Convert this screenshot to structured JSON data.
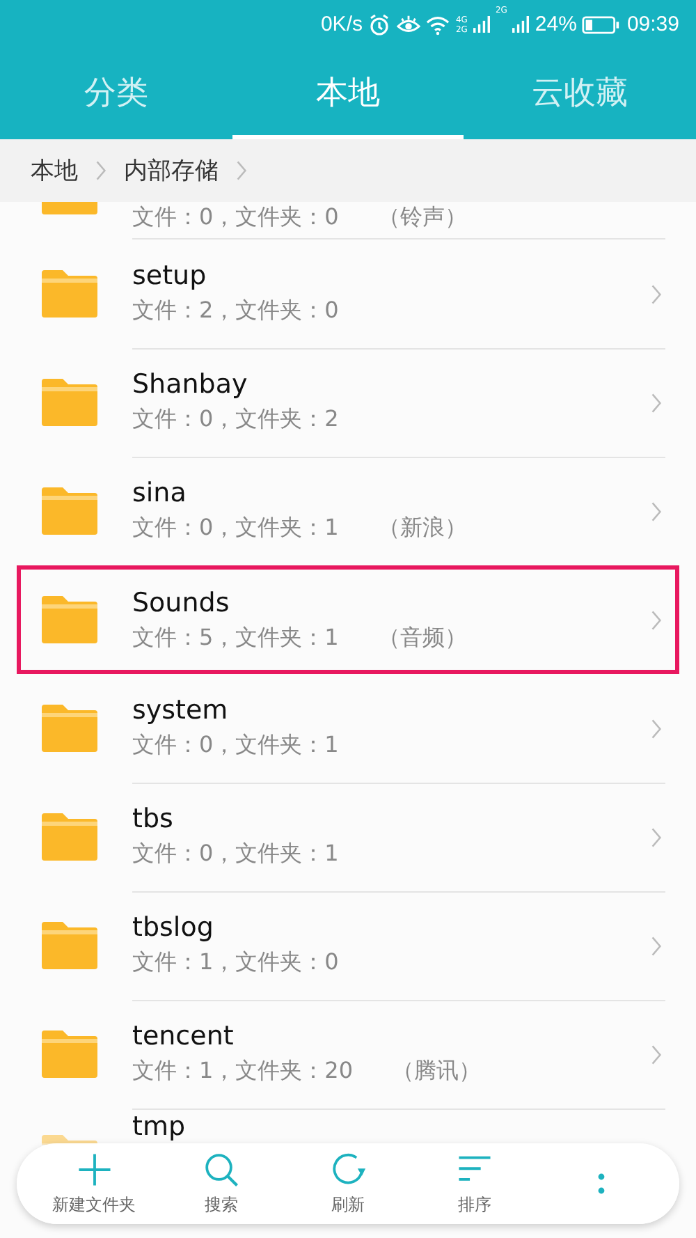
{
  "status_bar": {
    "speed": "0K/s",
    "network_labels": [
      "4G",
      "2G"
    ],
    "network_label_2": "2G",
    "battery_text": "24%",
    "time": "09:39"
  },
  "tabs": [
    {
      "label": "分类",
      "selected": false
    },
    {
      "label": "本地",
      "selected": true
    },
    {
      "label": "云收藏",
      "selected": false
    }
  ],
  "breadcrumb": [
    "本地",
    "内部存储"
  ],
  "folders": [
    {
      "kind": "partial",
      "info": "文件：0，文件夹：0",
      "tag": "（铃声）",
      "highlighted": false
    },
    {
      "kind": "full",
      "name": "setup",
      "info": "文件：2，文件夹：0",
      "highlighted": false
    },
    {
      "kind": "full",
      "name": "Shanbay",
      "info": "文件：0，文件夹：2",
      "highlighted": false
    },
    {
      "kind": "full",
      "name": "sina",
      "info": "文件：0，文件夹：1",
      "tag": "（新浪）",
      "highlighted": false
    },
    {
      "kind": "full",
      "name": "Sounds",
      "info": "文件：5，文件夹：1",
      "tag": "（音频）",
      "highlighted": true
    },
    {
      "kind": "full",
      "name": "system",
      "info": "文件：0，文件夹：1",
      "highlighted": false
    },
    {
      "kind": "full",
      "name": "tbs",
      "info": "文件：0，文件夹：1",
      "highlighted": false
    },
    {
      "kind": "full",
      "name": "tbslog",
      "info": "文件：1，文件夹：0",
      "highlighted": false
    },
    {
      "kind": "full",
      "name": "tencent",
      "info": "文件：1，文件夹：20",
      "tag": "（腾讯）",
      "highlighted": false
    },
    {
      "kind": "covered",
      "name": "tmp",
      "highlighted": false
    }
  ],
  "toolbar": [
    {
      "kind": "plus",
      "label": "新建文件夹"
    },
    {
      "kind": "search",
      "label": "搜索"
    },
    {
      "kind": "refresh",
      "label": "刷新"
    },
    {
      "kind": "sort",
      "label": "排序"
    },
    {
      "kind": "more"
    }
  ]
}
